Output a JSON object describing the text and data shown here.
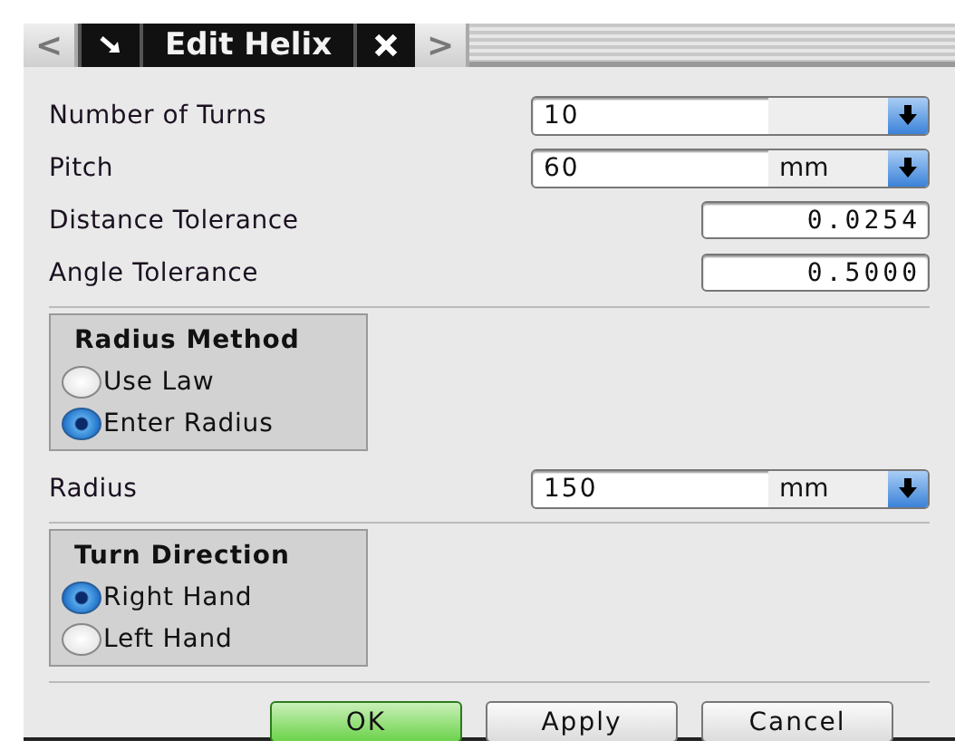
{
  "title_bar": {
    "prev": "<",
    "title": "Edit Helix",
    "next": ">"
  },
  "rows": [
    {
      "kind": "combo",
      "label": "Number of Turns",
      "value": "10"
    },
    {
      "kind": "combo",
      "label": "Pitch",
      "value": "60",
      "unit": "mm"
    },
    {
      "kind": "number",
      "label": "Distance Tolerance",
      "value": "0.0254"
    },
    {
      "kind": "number",
      "label": "Angle Tolerance",
      "value": "0.5000",
      "divider": true
    },
    {
      "kind": "group",
      "title": "Radius Method",
      "options": [
        {
          "label": "Use Law",
          "selected": false
        },
        {
          "label": "Enter Radius",
          "selected": true
        }
      ]
    },
    {
      "kind": "combo",
      "label": "Radius",
      "value": "150",
      "unit": "mm",
      "divider": true
    },
    {
      "kind": "group",
      "title": "Turn Direction",
      "options": [
        {
          "label": "Right Hand",
          "selected": true
        },
        {
          "label": "Left Hand",
          "selected": false
        }
      ]
    }
  ],
  "buttons": [
    {
      "label": "OK",
      "kind": "default"
    },
    {
      "label": "Apply",
      "kind": "normal"
    },
    {
      "label": "Cancel",
      "kind": "normal"
    }
  ]
}
